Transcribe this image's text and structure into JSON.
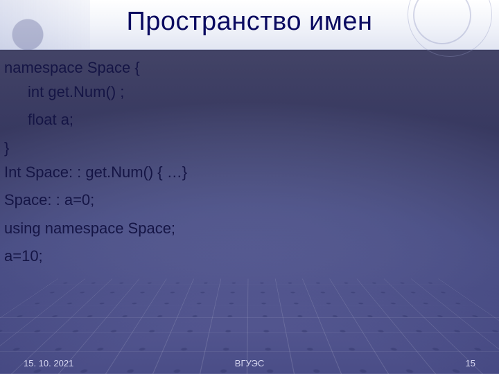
{
  "title": "Пространство имен",
  "code": {
    "l1": "namespace Space {",
    "l2": "int get.Num() ;",
    "l3": "float a;",
    "l4": "}",
    "l5": "Int Space: : get.Num() { …}",
    "l6": "Space: : a=0;",
    "l7": "using namespace Space;",
    "l8": "a=10;"
  },
  "footer": {
    "date": "15. 10. 2021",
    "org": "ВГУЭС",
    "page": "15"
  }
}
